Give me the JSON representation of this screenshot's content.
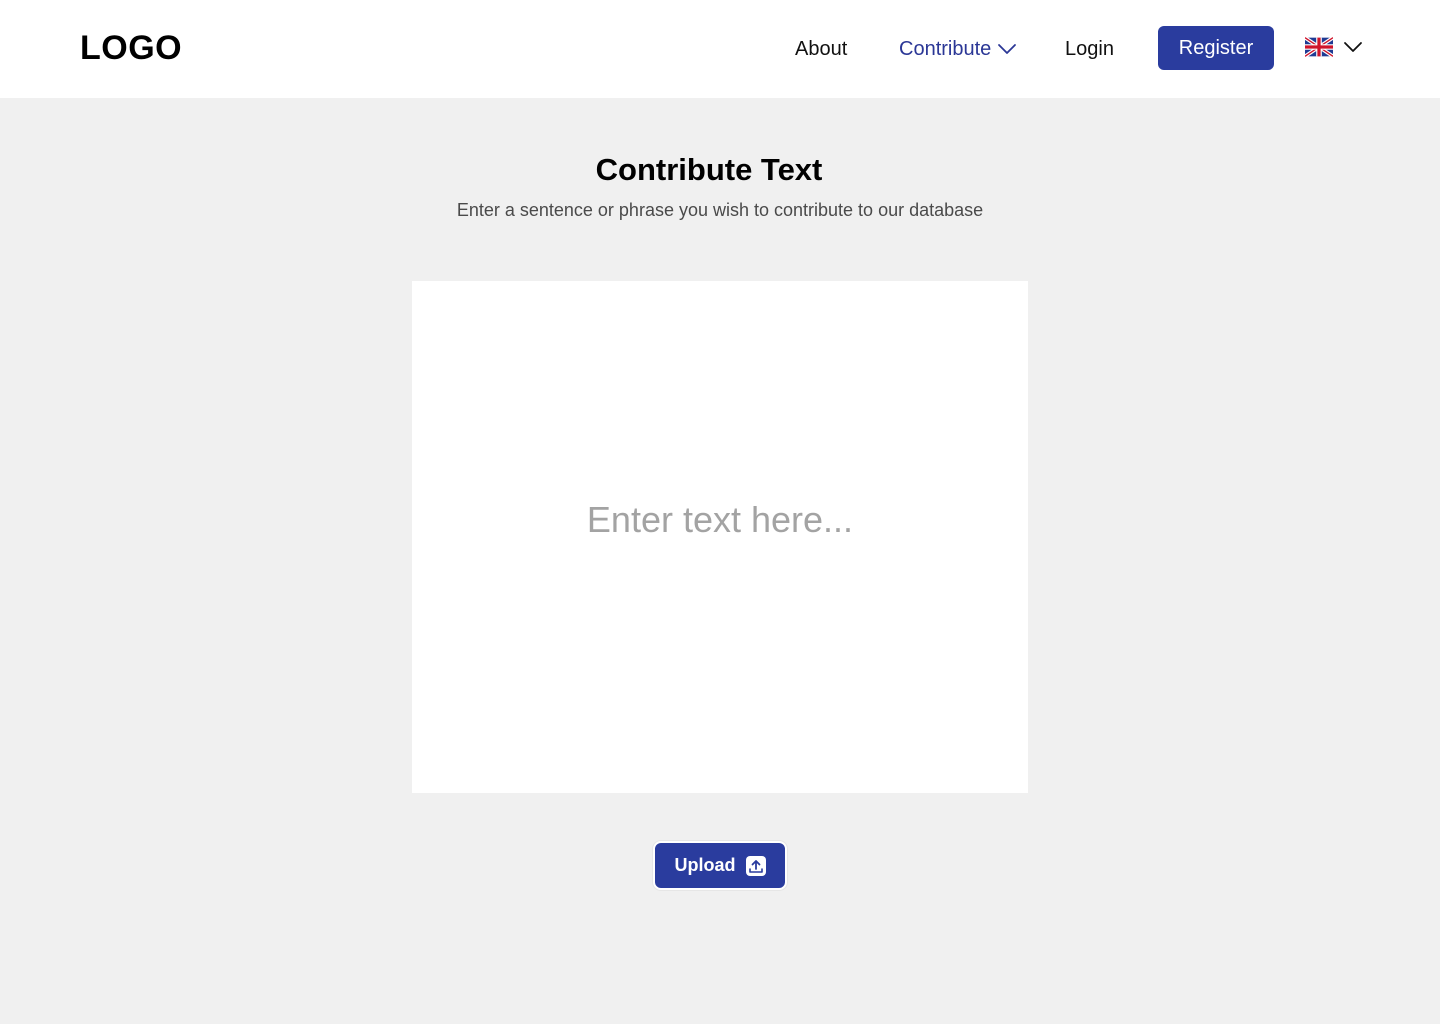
{
  "header": {
    "logo": "LOGO",
    "nav": {
      "about": "About",
      "contribute": "Contribute",
      "login": "Login"
    },
    "register_label": "Register",
    "language_icon": "uk-flag-icon"
  },
  "main": {
    "title": "Contribute Text",
    "subtitle": "Enter a sentence or phrase you wish to contribute to our database",
    "input_placeholder": "Enter text here...",
    "input_value": "",
    "upload_label": "Upload",
    "upload_icon": "upload-icon"
  },
  "colors": {
    "accent": "#2a3c9e",
    "active_nav": "#2b3796",
    "background": "#f0f0f0",
    "header_bg": "#ffffff"
  }
}
